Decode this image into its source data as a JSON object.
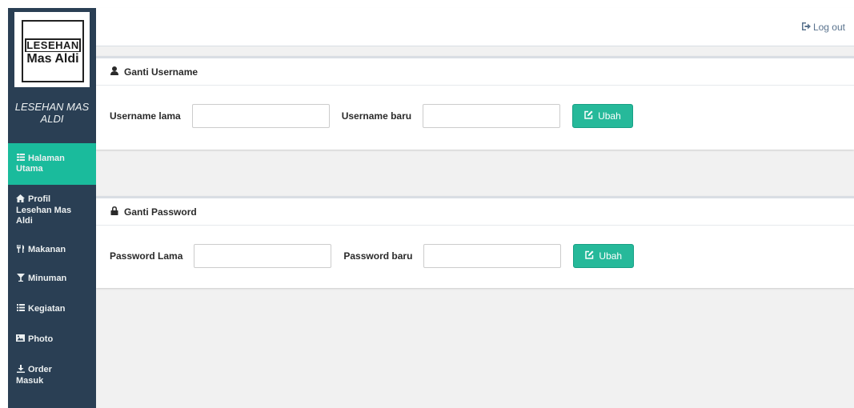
{
  "sidebar": {
    "logo_top": "LESEHAN",
    "logo_bottom": "Mas Aldi",
    "brand_line1": "LESEHAN MAS",
    "brand_line2": "ALDI",
    "items": [
      {
        "label_line1": "Halaman",
        "label_line2": "Utama",
        "icon": "table-icon",
        "active": true
      },
      {
        "label_line1": "Profil",
        "label_line2": "Lesehan Mas",
        "label_line3": "Aldi",
        "icon": "home-icon",
        "active": false
      },
      {
        "label_line1": "Makanan",
        "icon": "cutlery-icon",
        "active": false
      },
      {
        "label_line1": "Minuman",
        "icon": "glass-icon",
        "active": false
      },
      {
        "label_line1": "Kegiatan",
        "icon": "list-icon",
        "active": false
      },
      {
        "label_line1": "Photo",
        "icon": "picture-icon",
        "active": false
      },
      {
        "label_line1": "Order",
        "label_line2": "Masuk",
        "icon": "download-icon",
        "active": false
      }
    ]
  },
  "topbar": {
    "logout_label": "Log out"
  },
  "username_panel": {
    "title": "Ganti Username",
    "old_label": "Username lama",
    "new_label": "Username baru",
    "old_value": "",
    "new_value": "",
    "button_label": "Ubah"
  },
  "password_panel": {
    "title": "Ganti Password",
    "old_label": "Password Lama",
    "new_label": "Password baru",
    "old_value": "",
    "new_value": "",
    "button_label": "Ubah"
  },
  "colors": {
    "sidebar_bg": "#2a3f54",
    "active_item": "#1abb9c",
    "button_bg": "#26b99a",
    "content_bg": "#f1f1f1"
  }
}
